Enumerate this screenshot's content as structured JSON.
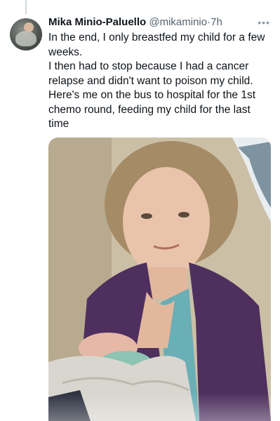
{
  "tweet": {
    "author_name": "Mika Minio-Paluello",
    "handle": "@mikaminio",
    "separator": "·",
    "time": "7h",
    "more_icon": "more-horizontal-icon",
    "text": "In the end, I only breastfed my child for a few weeks.\nI then had to stop because I had a cancer relapse and didn't want to poison my child. Here's me on the bus to hospital for the 1st chemo round, feeding my child for the last time",
    "media": {
      "kind": "photo"
    }
  },
  "colors": {
    "text": "#0f1419",
    "secondary": "#536471",
    "thread_line": "#cfd9de",
    "cardigan": "#4e2f5e",
    "top": "#6aaeb6",
    "blanket": "#d9d6cf"
  }
}
